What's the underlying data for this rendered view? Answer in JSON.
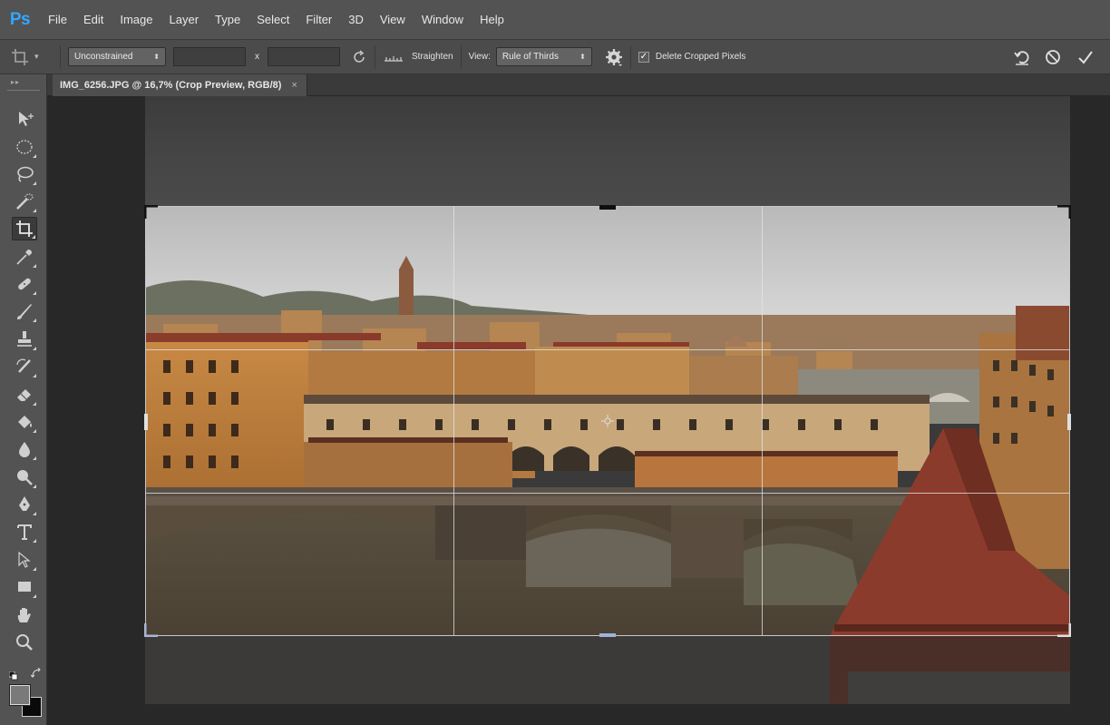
{
  "app": {
    "logo": "Ps"
  },
  "menu": [
    "File",
    "Edit",
    "Image",
    "Layer",
    "Type",
    "Select",
    "Filter",
    "3D",
    "View",
    "Window",
    "Help"
  ],
  "options": {
    "tool_icon": "crop-icon",
    "ratio_preset": "Unconstrained",
    "width_value": "",
    "height_value": "",
    "times_symbol": "x",
    "straighten_label": "Straighten",
    "view_label": "View:",
    "view_overlay": "Rule of Thirds",
    "delete_cropped_label": "Delete Cropped Pixels",
    "delete_cropped_checked": true,
    "commit_icons": [
      "reset-icon",
      "cancel-icon",
      "commit-check-icon"
    ]
  },
  "document": {
    "tab_title": "IMG_6256.JPG @ 16,7% (Crop Preview, RGB/8)",
    "tab_close": "×"
  },
  "tools": [
    "move-tool-icon",
    "elliptical-marquee-icon",
    "lasso-icon",
    "quick-selection-icon",
    "crop-tool-icon",
    "eyedropper-icon",
    "spot-healing-icon",
    "brush-icon",
    "clone-stamp-icon",
    "history-brush-icon",
    "eraser-icon",
    "paint-bucket-icon",
    "blur-icon",
    "dodge-icon",
    "pen-icon",
    "type-icon",
    "path-selection-icon",
    "rectangle-icon",
    "hand-icon",
    "zoom-icon"
  ],
  "colors": {
    "accent": "#31a8ff",
    "foreground": "#0a0a0a",
    "background": "#7a7a7a"
  }
}
